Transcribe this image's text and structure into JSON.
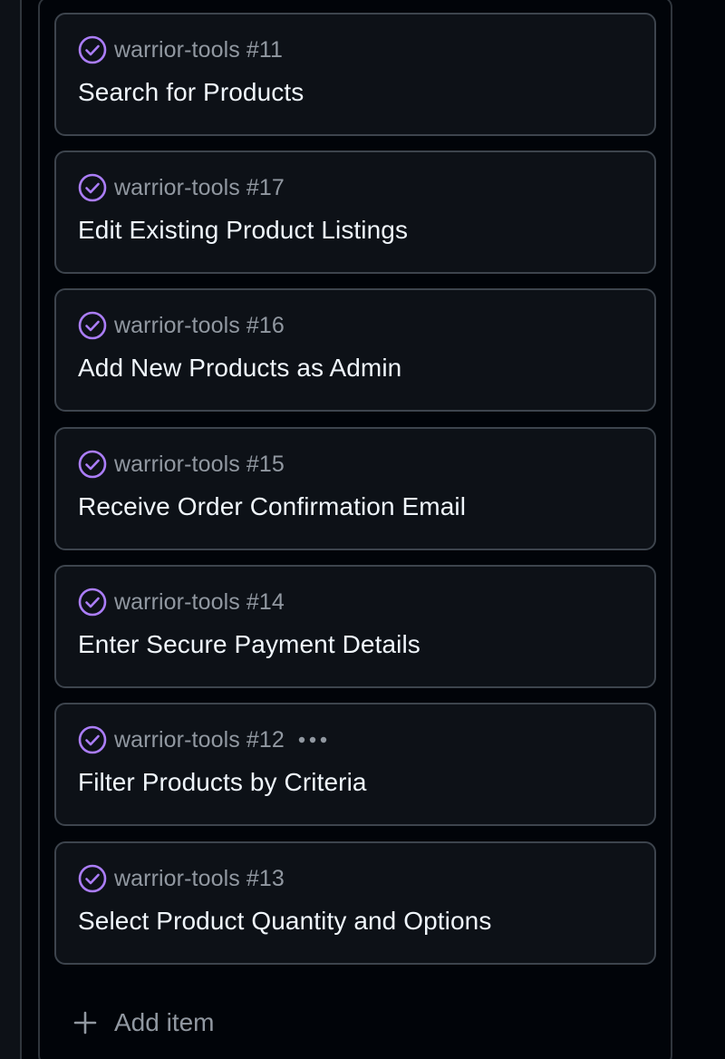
{
  "cards": [
    {
      "ref": "warrior-tools #11",
      "title": "Search for Products",
      "status_icon": "issue-closed-icon"
    },
    {
      "ref": "warrior-tools #17",
      "title": "Edit Existing Product Listings",
      "status_icon": "issue-closed-icon"
    },
    {
      "ref": "warrior-tools #16",
      "title": "Add New Products as Admin",
      "status_icon": "issue-closed-icon"
    },
    {
      "ref": "warrior-tools #15",
      "title": "Receive Order Confirmation Email",
      "status_icon": "issue-closed-icon"
    },
    {
      "ref": "warrior-tools #14",
      "title": "Enter Secure Payment Details",
      "status_icon": "issue-closed-icon"
    },
    {
      "ref": "warrior-tools #12",
      "title": "Filter Products by Criteria",
      "status_icon": "issue-closed-icon",
      "menu_icon": "kebab-horizontal-icon"
    },
    {
      "ref": "warrior-tools #13",
      "title": "Select Product Quantity and Options",
      "status_icon": "issue-closed-icon"
    }
  ],
  "add_item": {
    "label": "Add item",
    "icon": "plus-icon"
  },
  "colors": {
    "background": "#010409",
    "card_background": "#0d1117",
    "card_border": "#3d444d",
    "done_purple": "#ab7df8",
    "title_text": "#f0f6fc",
    "muted_text": "#9198a1"
  }
}
